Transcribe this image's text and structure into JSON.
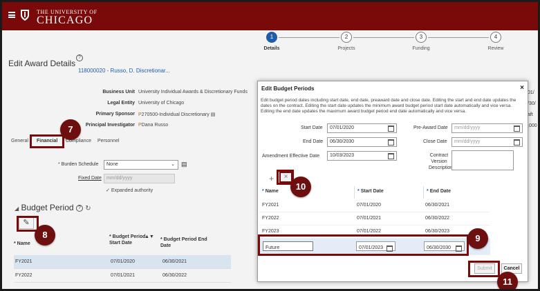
{
  "header": {
    "brand_small": "THE UNIVERSITY OF",
    "brand_big": "CHICAGO"
  },
  "steps": [
    {
      "num": "1",
      "label": "Details"
    },
    {
      "num": "2",
      "label": "Projects"
    },
    {
      "num": "3",
      "label": "Funding"
    },
    {
      "num": "4",
      "label": "Review"
    }
  ],
  "page": {
    "title": "Edit Award Details",
    "help_glyph": "?",
    "award_link": "118000020 - Russo, D. Discretionar...",
    "info": [
      {
        "key": "Business Unit",
        "value": "University Individual Awards & Discretionary Funds"
      },
      {
        "key": "Legal Entity",
        "value": "University of Chicago"
      },
      {
        "key": "Primary Sponsor",
        "prefix": "P",
        "value": "270500-Individual Discretionary"
      },
      {
        "key": "Principal Investigator",
        "prefix": "P",
        "value": "Dana Russo"
      }
    ],
    "right_edge_fragments": [
      "01/",
      "/30/",
      "aft",
      ",000"
    ],
    "tabs": [
      "General",
      "Financial",
      "Compliance",
      "Personnel"
    ],
    "burden_label": "Burden Schedule",
    "burden_value": "None",
    "fixed_date_label": "Fixed Date",
    "fixed_date_placeholder": "mm/dd/yyyy",
    "expanded_label": "Expanded authority",
    "section_title": "Budget Period",
    "table_headers": [
      "Name",
      "Budget Period Start Date",
      "Budget Period End Date"
    ],
    "rows": [
      {
        "name": "FY2021",
        "start": "07/01/2020",
        "end": "06/30/2021"
      },
      {
        "name": "FY2022",
        "start": "07/01/2021",
        "end": "06/30/2022"
      }
    ]
  },
  "modal": {
    "title": "Edit Budget Periods",
    "close": "×",
    "description": "Edit budget period dates including start date, end date, preaward date and close date. Editing the start and end date updates the dates on the contract. Editing the start date updates the minimum award budget period start date automatically and vice versa. Editing the end date updates the maximum award budget period end date automatically and vice versa.",
    "start_date_label": "Start Date",
    "start_date": "07/01/2020",
    "end_date_label": "End Date",
    "end_date": "06/30/2030",
    "amend_label": "Amendment Effective Date",
    "amend_date": "10/03/2023",
    "preaward_label": "Pre-Award Date",
    "close_date_label": "Close Date",
    "date_placeholder": "mm/dd/yyyy",
    "contract_label_1": "Contract",
    "contract_label_2": "Version",
    "contract_label_3": "Description",
    "plus": "+",
    "delete": "×",
    "table_headers": [
      "Name",
      "Start Date",
      "End Date"
    ],
    "required_mark": "*",
    "rows": [
      {
        "name": "FY2021",
        "start": "07/01/2020",
        "end": "06/30/2021"
      },
      {
        "name": "FY2022",
        "start": "07/01/2021",
        "end": "06/30/2022"
      },
      {
        "name": "FY2023",
        "start": "07/01/2022",
        "end": "06/30/2023"
      }
    ],
    "new_row": {
      "name": "Future",
      "start": "07/01/2023",
      "end": "06/30/2030"
    },
    "submit": "Submit",
    "cancel": "Cancel"
  },
  "callouts": [
    "7",
    "8",
    "9",
    "10",
    "11"
  ],
  "colors": {
    "brand": "#7a0a0a",
    "accent": "#1f5da8"
  }
}
